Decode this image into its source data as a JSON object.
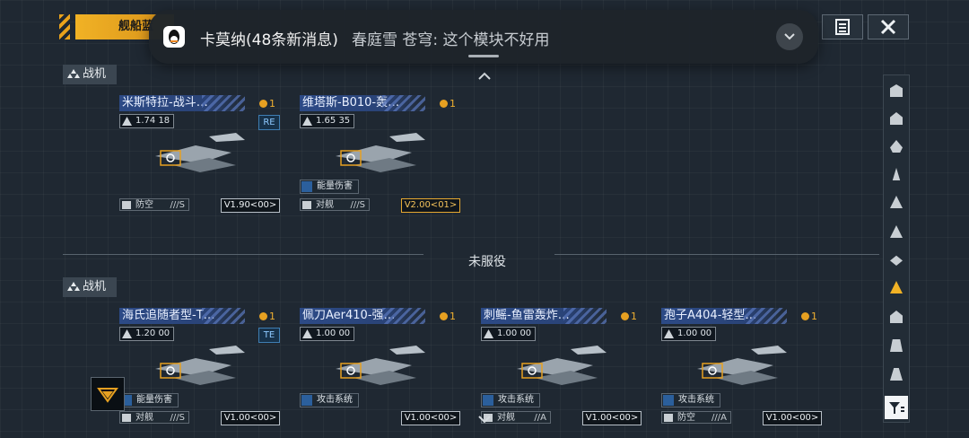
{
  "top": {
    "tab_label": "舰船蓝"
  },
  "notification": {
    "title": "卡莫纳(48条新消息)",
    "message": "春庭雪  苍穹: 这个模块不好用"
  },
  "sections": [
    {
      "label": "战机"
    },
    {
      "label": "战机"
    }
  ],
  "divider_label": "未服役",
  "cards": [
    {
      "name": "米斯特拉-战斗…",
      "cost": "1",
      "stat": "1.74 18",
      "badge": "RE",
      "tags": [],
      "role": "防空",
      "rank": "///S",
      "version": "V1.90<00>",
      "gold": false
    },
    {
      "name": "维塔斯-B010-轰…",
      "cost": "1",
      "stat": "1.65 35",
      "badge": "",
      "tags": [
        "能量伤害"
      ],
      "role": "对舰",
      "rank": "///S",
      "version": "V2.00<01>",
      "gold": true
    },
    {
      "name": "海氏追随者型-T…",
      "cost": "1",
      "stat": "1.20 00",
      "badge": "TE",
      "tags": [
        "能量伤害"
      ],
      "role": "对舰",
      "rank": "///S",
      "version": "V1.00<00>",
      "gold": false
    },
    {
      "name": "佩刀Aer410-强…",
      "cost": "1",
      "stat": "1.00 00",
      "badge": "",
      "tags": [
        "攻击系统"
      ],
      "role": "",
      "rank": "",
      "version": "V1.00<00>",
      "gold": false
    },
    {
      "name": "刺鳐-鱼雷轰炸…",
      "cost": "1",
      "stat": "1.00 00",
      "badge": "",
      "tags": [
        "攻击系统"
      ],
      "role": "对舰",
      "rank": "//A",
      "version": "V1.00<00>",
      "gold": false
    },
    {
      "name": "孢子A404-轻型…",
      "cost": "1",
      "stat": "1.00 00",
      "badge": "",
      "tags": [
        "攻击系统"
      ],
      "role": "防空",
      "rank": "///A",
      "version": "V1.00<00>",
      "gold": false
    }
  ],
  "colors": {
    "accent": "#f1b225",
    "panel": "#1f2832",
    "blue_title": "#2c4a86"
  }
}
